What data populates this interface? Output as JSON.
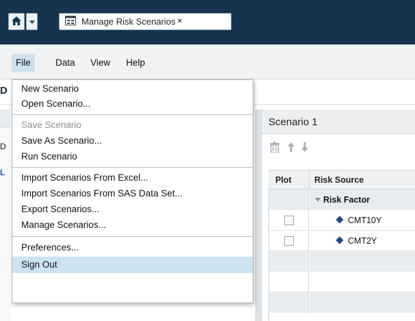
{
  "header": {
    "tab_label": "Manage Risk Scenarios",
    "tab_close": "×"
  },
  "menubar": {
    "items": [
      "File",
      "Data",
      "View",
      "Help"
    ],
    "active": "File"
  },
  "background": {
    "heading_fragment": "D",
    "row_fragment": "D",
    "link_fragment": "L"
  },
  "panel": {
    "title": "Scenario 1",
    "toolbar_icons": [
      "trash-icon",
      "arrow-up-icon",
      "arrow-down-icon"
    ],
    "columns": [
      "Plot",
      "Risk Source"
    ],
    "group_label": "Risk Factor",
    "rows": [
      {
        "label": "CMT10Y",
        "checked": false
      },
      {
        "label": "CMT2Y",
        "checked": false
      }
    ]
  },
  "file_menu": {
    "groups": [
      [
        {
          "label": "New Scenario",
          "enabled": true
        },
        {
          "label": "Open Scenario...",
          "enabled": true
        }
      ],
      [
        {
          "label": "Save Scenario",
          "enabled": false
        },
        {
          "label": "Save As Scenario...",
          "enabled": true
        },
        {
          "label": "Run Scenario",
          "enabled": true
        }
      ],
      [
        {
          "label": "Import Scenarios From Excel...",
          "enabled": true
        },
        {
          "label": "Import Scenarios From SAS Data Set...",
          "enabled": true
        },
        {
          "label": "Export Scenarios...",
          "enabled": true
        },
        {
          "label": "Manage Scenarios...",
          "enabled": true
        }
      ],
      [
        {
          "label": "Preferences...",
          "enabled": true
        },
        {
          "label": "Sign Out",
          "enabled": true,
          "highlighted": true
        }
      ]
    ]
  },
  "colors": {
    "header_bg": "#16334f",
    "menu_active": "#cfe1ef",
    "highlight": "#cde2f1",
    "diamond": "#1e4d86"
  }
}
